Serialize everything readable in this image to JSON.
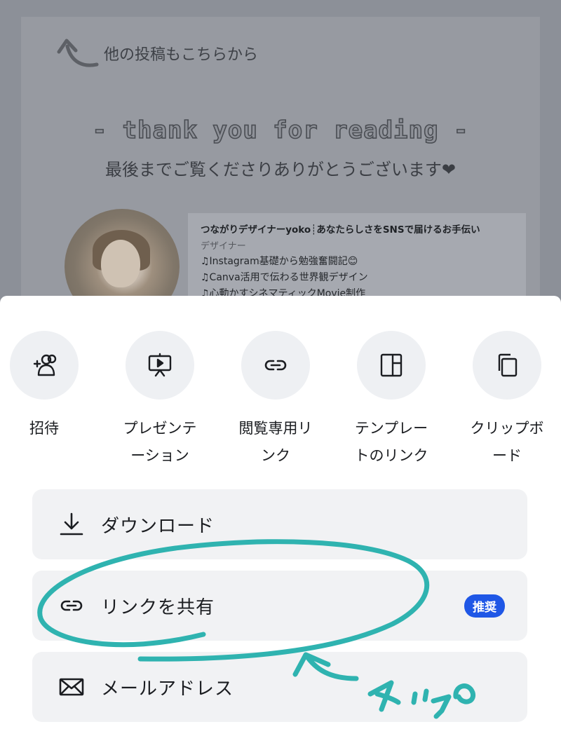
{
  "background": {
    "more_posts": "他の投稿もこちらから",
    "thanks_title": "- thank you for reading -",
    "thanks_sub": "最後までご覧くださりありがとうございます❤",
    "profile": {
      "name": "つながりデザイナーyoko┊あなたらしさをSNSで届けるお手伝い",
      "role": "デザイナー",
      "lines": [
        "♫Instagram基礎から勉強奮闘記😊",
        "♫Canva活用で伝わる世界観デザイン",
        "♫心動かすシネマティックMovie制作"
      ]
    }
  },
  "share_options": [
    {
      "label": "招待",
      "icon": "add-people-icon"
    },
    {
      "label": "プレゼンテ\nーション",
      "icon": "presentation-icon"
    },
    {
      "label": "閲覧専用リ\nンク",
      "icon": "link-icon"
    },
    {
      "label": "テンプレー\nトのリンク",
      "icon": "template-icon"
    },
    {
      "label": "クリップボ\nード",
      "icon": "copy-icon"
    }
  ],
  "actions": {
    "download": {
      "label": "ダウンロード",
      "icon": "download-icon"
    },
    "share_link": {
      "label": "リンクを共有",
      "icon": "link-icon",
      "badge": "推奨"
    },
    "email": {
      "label": "メールアドレス",
      "icon": "mail-icon"
    }
  },
  "annotation": {
    "text": "タップ",
    "color": "#2fb3b0"
  },
  "colors": {
    "badge": "#1f57e6",
    "overlay": "#8c9098",
    "sheet": "#ffffff",
    "row": "#f1f2f4"
  }
}
